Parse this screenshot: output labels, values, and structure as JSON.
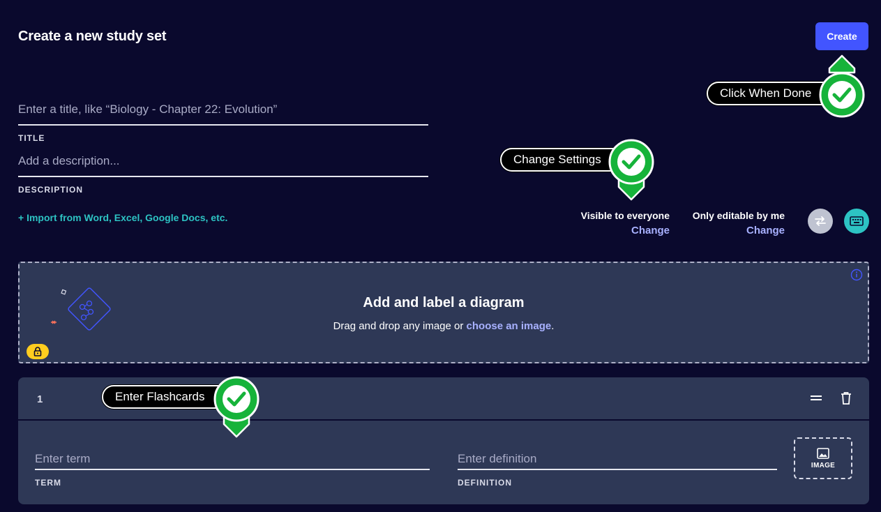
{
  "header": {
    "title": "Create a new study set",
    "create_label": "Create"
  },
  "title_field": {
    "placeholder": "Enter a title, like “Biology - Chapter 22: Evolution”",
    "label": "TITLE"
  },
  "description_field": {
    "placeholder": "Add a description...",
    "label": "DESCRIPTION"
  },
  "import_link": "+ Import from Word, Excel, Google Docs, etc.",
  "settings": {
    "visibility_label": "Visible to everyone",
    "visibility_change": "Change",
    "edit_label": "Only editable by me",
    "edit_change": "Change"
  },
  "callouts": {
    "done": "Click When Done",
    "settings": "Change Settings",
    "flashcards": "Enter Flashcards"
  },
  "diagram": {
    "title": "Add and label a diagram",
    "subtitle_prefix": "Drag and drop any image or ",
    "subtitle_link": "choose an image",
    "subtitle_suffix": "."
  },
  "card": {
    "number": "1",
    "term_placeholder": "Enter term",
    "term_label": "TERM",
    "definition_placeholder": "Enter definition",
    "definition_label": "DEFINITION",
    "image_label": "IMAGE"
  },
  "colors": {
    "background": "#0a092d",
    "panel": "#2e3856",
    "accent_blue": "#4255ff",
    "accent_teal": "#2dc3c3",
    "link_lavender": "#a8b1ff",
    "check_green": "#16b33a",
    "lock_yellow": "#ffcd1f"
  },
  "icons": {
    "swap": "swap-icon",
    "keyboard": "keyboard-icon",
    "info": "info-icon",
    "lock": "lock-icon",
    "reorder": "drag-handle-icon",
    "delete": "trash-icon",
    "image": "image-icon",
    "check": "checkmark-icon"
  }
}
